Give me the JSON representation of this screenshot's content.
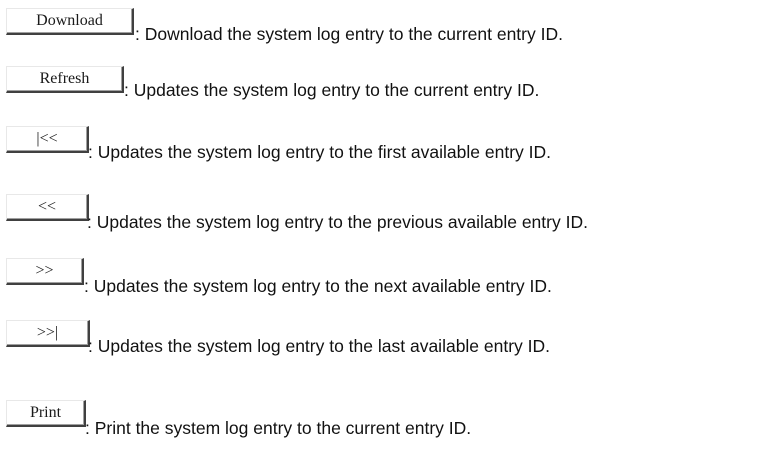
{
  "items": [
    {
      "button_label": "Download",
      "description": ": Download the system log entry to the current entry ID."
    },
    {
      "button_label": "Refresh",
      "description": ": Updates the system log entry to the current entry ID."
    },
    {
      "button_label": "|<<",
      "description": ": Updates the system log entry to the first available entry ID."
    },
    {
      "button_label": "<<",
      "description": ": Updates the system log entry to the previous available entry ID."
    },
    {
      "button_label": ">>",
      "description": ": Updates the system log entry to the next available entry ID."
    },
    {
      "button_label": ">>|",
      "description": ": Updates the system log entry to the last available entry ID."
    },
    {
      "button_label": "Print",
      "description": ": Print the system log entry to the current entry ID."
    }
  ]
}
